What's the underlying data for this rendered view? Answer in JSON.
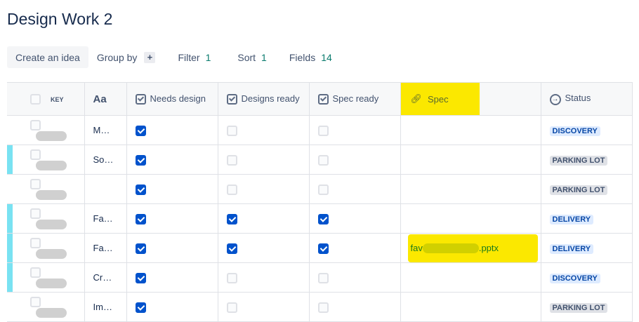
{
  "page_title": "Design Work 2",
  "toolbar": {
    "create": "Create an idea",
    "group_by": "Group by",
    "group_plus": "+",
    "filter": "Filter",
    "filter_count": "1",
    "sort": "Sort",
    "sort_count": "1",
    "fields": "Fields",
    "fields_count": "14"
  },
  "columns": {
    "key": "KEY",
    "summary": "Aa",
    "needs_design": "Needs design",
    "designs_ready": "Designs ready",
    "spec_ready": "Spec ready",
    "spec": "Spec",
    "status": "Status"
  },
  "rows": [
    {
      "summary": "M…",
      "needs_design": true,
      "designs_ready": false,
      "spec_ready": false,
      "spec_prefix": "",
      "spec_suffix": "",
      "status": "DISCOVERY",
      "status_type": "discovery",
      "indicator": false
    },
    {
      "summary": "So…",
      "needs_design": true,
      "designs_ready": false,
      "spec_ready": false,
      "spec_prefix": "",
      "spec_suffix": "",
      "status": "PARKING LOT",
      "status_type": "parking",
      "indicator": true
    },
    {
      "summary": "",
      "needs_design": true,
      "designs_ready": false,
      "spec_ready": false,
      "spec_prefix": "",
      "spec_suffix": "",
      "status": "PARKING LOT",
      "status_type": "parking",
      "indicator": false
    },
    {
      "summary": "Fa…",
      "needs_design": true,
      "designs_ready": true,
      "spec_ready": true,
      "spec_prefix": "",
      "spec_suffix": "",
      "status": "DELIVERY",
      "status_type": "delivery",
      "indicator": true
    },
    {
      "summary": "Fa…",
      "needs_design": true,
      "designs_ready": true,
      "spec_ready": true,
      "spec_prefix": "fav",
      "spec_suffix": ".pptx",
      "status": "DELIVERY",
      "status_type": "delivery",
      "indicator": true
    },
    {
      "summary": "Cr…",
      "needs_design": true,
      "designs_ready": false,
      "spec_ready": false,
      "spec_prefix": "",
      "spec_suffix": "",
      "status": "DISCOVERY",
      "status_type": "discovery",
      "indicator": true
    },
    {
      "summary": "Im…",
      "needs_design": true,
      "designs_ready": false,
      "spec_ready": false,
      "spec_prefix": "",
      "spec_suffix": "",
      "status": "PARKING LOT",
      "status_type": "parking",
      "indicator": false
    }
  ]
}
